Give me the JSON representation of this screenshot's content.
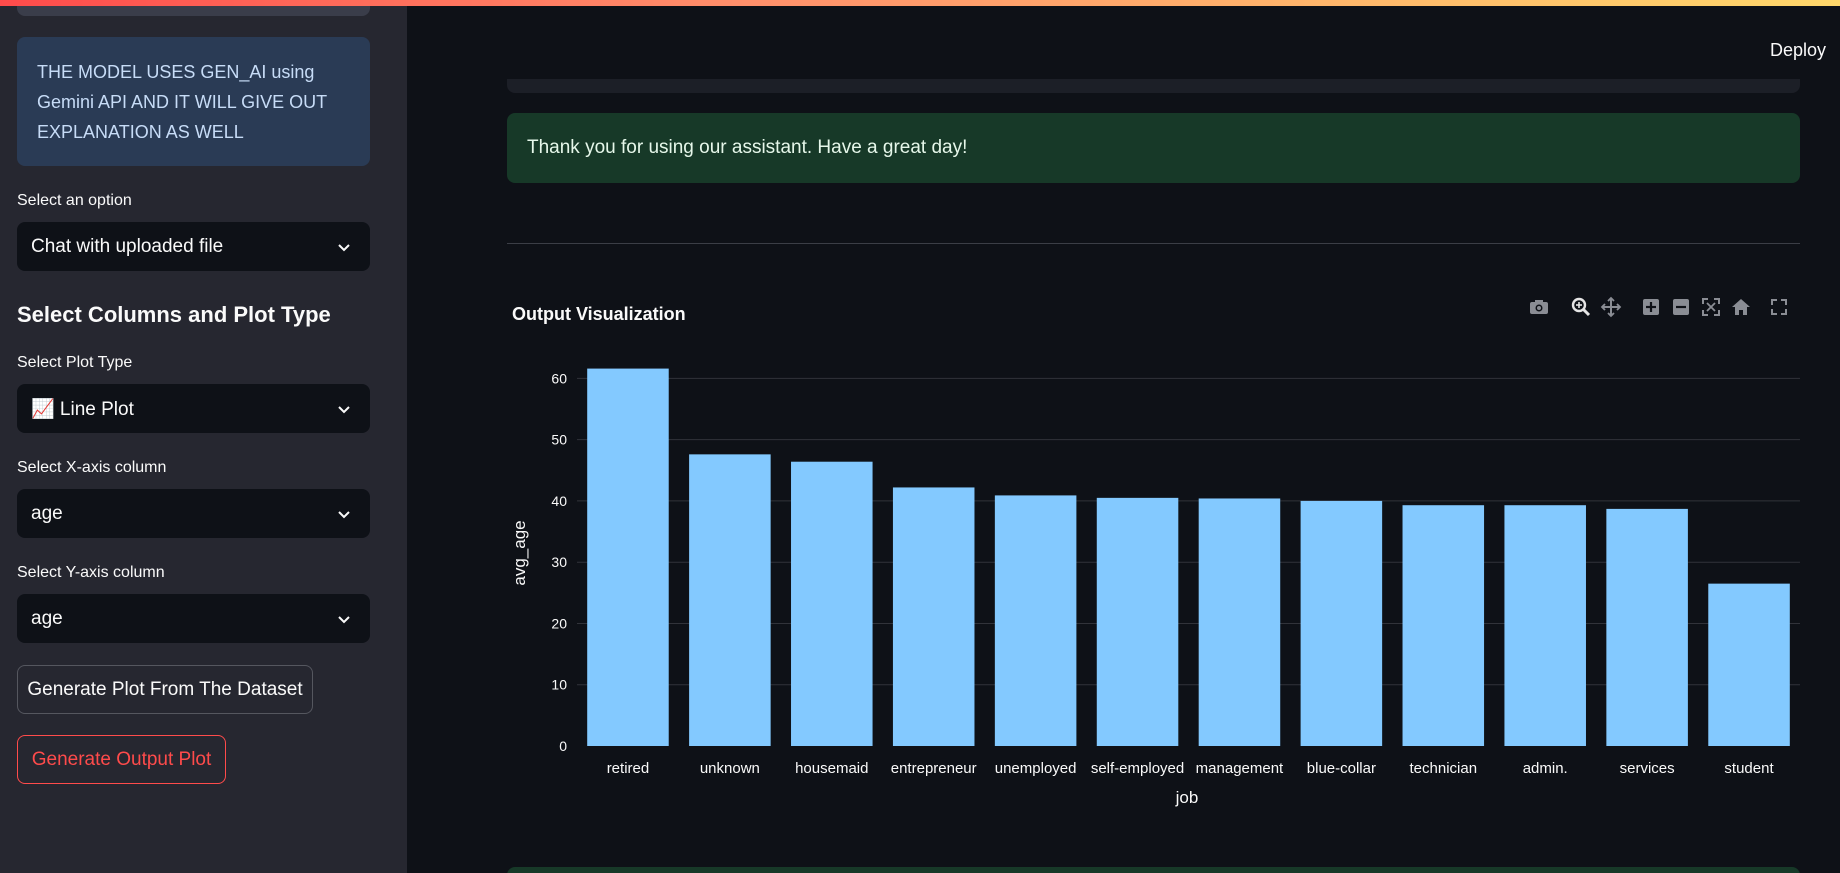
{
  "sidebar": {
    "info_text": "THE MODEL USES GEN_AI using Gemini API AND IT WILL GIVE OUT EXPLANATION AS WELL",
    "option_label": "Select an option",
    "option_value": "Chat with uploaded file",
    "section_heading": "Select Columns and Plot Type",
    "plot_type_label": "Select Plot Type",
    "plot_type_value": "📈 Line Plot",
    "x_label": "Select X-axis column",
    "x_value": "age",
    "y_label": "Select Y-axis column",
    "y_value": "age",
    "generate_button": "Generate Plot From The Dataset",
    "output_button": "Generate Output Plot"
  },
  "header": {
    "deploy_label": "Deploy"
  },
  "main": {
    "success_message": "Thank you for using our assistant. Have a great day!",
    "chart_title": "Output Visualization"
  },
  "modebar_icons": [
    "camera-icon",
    "zoom-icon",
    "pan-icon",
    "zoom-in-icon",
    "zoom-out-icon",
    "autoscale-icon",
    "reset-axes-icon",
    "fullscreen-icon"
  ],
  "colors": {
    "bar": "#83c9ff",
    "accent": "#ff4b4b",
    "success_bg": "#173928",
    "info_bg": "#2a3b55"
  },
  "chart_data": {
    "type": "bar",
    "title": "Output Visualization",
    "xlabel": "job",
    "ylabel": "avg_age",
    "categories": [
      "retired",
      "unknown",
      "housemaid",
      "entrepreneur",
      "unemployed",
      "self-employed",
      "management",
      "blue-collar",
      "technician",
      "admin.",
      "services",
      "student"
    ],
    "values": [
      61.6,
      47.6,
      46.4,
      42.2,
      40.9,
      40.5,
      40.4,
      40.0,
      39.3,
      39.3,
      38.7,
      26.5
    ],
    "ylim": [
      0,
      63
    ],
    "yticks": [
      0,
      10,
      20,
      30,
      40,
      50,
      60
    ],
    "grid": true
  }
}
